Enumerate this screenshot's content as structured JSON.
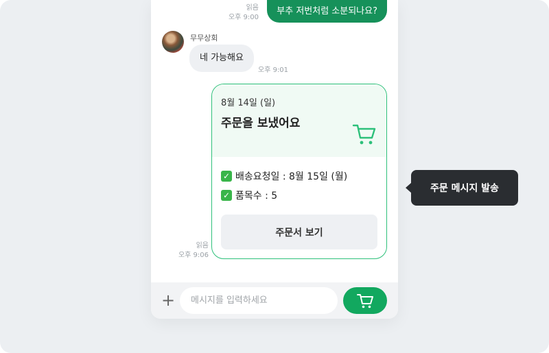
{
  "chat": {
    "sent_message": {
      "text": "부추 저번처럼 소분되나요?",
      "read_label": "읽음",
      "time": "오후 9:00"
    },
    "received_message": {
      "sender": "무무상회",
      "text": "네 가능해요",
      "time": "오후 9:01"
    },
    "order_message": {
      "read_label": "읽음",
      "time": "오후 9:06",
      "date": "8월 14일 (일)",
      "title": "주문을 보냈어요",
      "delivery_request_line": "배송요청일 : 8월 15일 (월)",
      "item_count_line": "품목수 : 5",
      "check_glyph": "✓",
      "view_button_label": "주문서 보기"
    }
  },
  "input_bar": {
    "plus_glyph": "+",
    "placeholder": "메시지를 입력하세요",
    "cart_icon": "cart-icon"
  },
  "tooltip": {
    "text": "주문 메시지 발송"
  },
  "colors": {
    "sent_bubble": "#16915a",
    "accent_green": "#2dc07a",
    "card_head_bg": "#f0faf4",
    "tooltip_bg": "#2a2d31"
  }
}
